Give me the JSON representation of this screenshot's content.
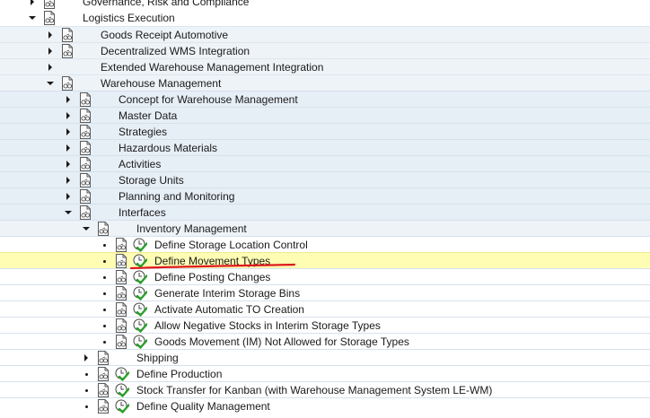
{
  "tree": {
    "items": [
      {
        "label": "Governance, Risk and Compliance",
        "level": 0,
        "state": "collapsed",
        "icon": "document-icon",
        "activity": false
      },
      {
        "label": "Logistics Execution",
        "level": 0,
        "state": "expanded",
        "icon": "document-icon",
        "activity": false
      },
      {
        "label": "Goods Receipt Automotive",
        "level": 1,
        "state": "collapsed",
        "icon": "document-icon",
        "activity": false
      },
      {
        "label": "Decentralized WMS Integration",
        "level": 1,
        "state": "collapsed",
        "icon": "document-icon",
        "activity": false
      },
      {
        "label": "Extended Warehouse Management Integration",
        "level": 1,
        "state": "collapsed",
        "icon": "none",
        "activity": false
      },
      {
        "label": "Warehouse Management",
        "level": 1,
        "state": "expanded",
        "icon": "document-icon",
        "activity": false
      },
      {
        "label": "Concept for Warehouse Management",
        "level": 2,
        "state": "collapsed",
        "icon": "document-icon",
        "activity": false
      },
      {
        "label": "Master Data",
        "level": 2,
        "state": "collapsed",
        "icon": "document-icon",
        "activity": false
      },
      {
        "label": "Strategies",
        "level": 2,
        "state": "collapsed",
        "icon": "document-icon",
        "activity": false
      },
      {
        "label": "Hazardous Materials",
        "level": 2,
        "state": "collapsed",
        "icon": "document-icon",
        "activity": false
      },
      {
        "label": "Activities",
        "level": 2,
        "state": "collapsed",
        "icon": "document-icon",
        "activity": false
      },
      {
        "label": "Storage Units",
        "level": 2,
        "state": "collapsed",
        "icon": "document-icon",
        "activity": false
      },
      {
        "label": "Planning and Monitoring",
        "level": 2,
        "state": "collapsed",
        "icon": "document-icon",
        "activity": false
      },
      {
        "label": "Interfaces",
        "level": 2,
        "state": "expanded",
        "icon": "document-icon",
        "activity": false
      },
      {
        "label": "Inventory Management",
        "level": 3,
        "state": "expanded",
        "icon": "document-icon",
        "activity": false
      },
      {
        "label": "Define Storage Location Control",
        "level": 4,
        "state": "leaf",
        "icon": "document-icon",
        "activity": true
      },
      {
        "label": "Define Movement Types",
        "level": 4,
        "state": "leaf",
        "icon": "document-icon",
        "activity": true,
        "selected": true
      },
      {
        "label": "Define Posting Changes",
        "level": 4,
        "state": "leaf",
        "icon": "document-icon",
        "activity": true
      },
      {
        "label": "Generate Interim Storage Bins",
        "level": 4,
        "state": "leaf",
        "icon": "document-icon",
        "activity": true
      },
      {
        "label": "Activate Automatic TO Creation",
        "level": 4,
        "state": "leaf",
        "icon": "document-icon",
        "activity": true
      },
      {
        "label": "Allow Negative Stocks in Interim Storage Types",
        "level": 4,
        "state": "leaf",
        "icon": "document-icon",
        "activity": true
      },
      {
        "label": "Goods Movement (IM) Not Allowed for Storage Types",
        "level": 4,
        "state": "leaf",
        "icon": "document-icon",
        "activity": true
      },
      {
        "label": "Shipping",
        "level": 3,
        "state": "collapsed",
        "icon": "document-icon",
        "activity": false
      },
      {
        "label": "Define Production",
        "level": 3,
        "state": "leaf",
        "icon": "document-icon",
        "activity": true
      },
      {
        "label": "Stock Transfer for Kanban (with Warehouse Management System LE-WM)",
        "level": 3,
        "state": "leaf",
        "icon": "document-icon",
        "activity": true
      },
      {
        "label": "Define Quality Management",
        "level": 3,
        "state": "leaf",
        "icon": "document-icon",
        "activity": true
      }
    ]
  },
  "colors": {
    "selection_highlight": "#fffdb4",
    "annotation_underline": "#e0191e",
    "activity_check": "#2aa02a"
  }
}
